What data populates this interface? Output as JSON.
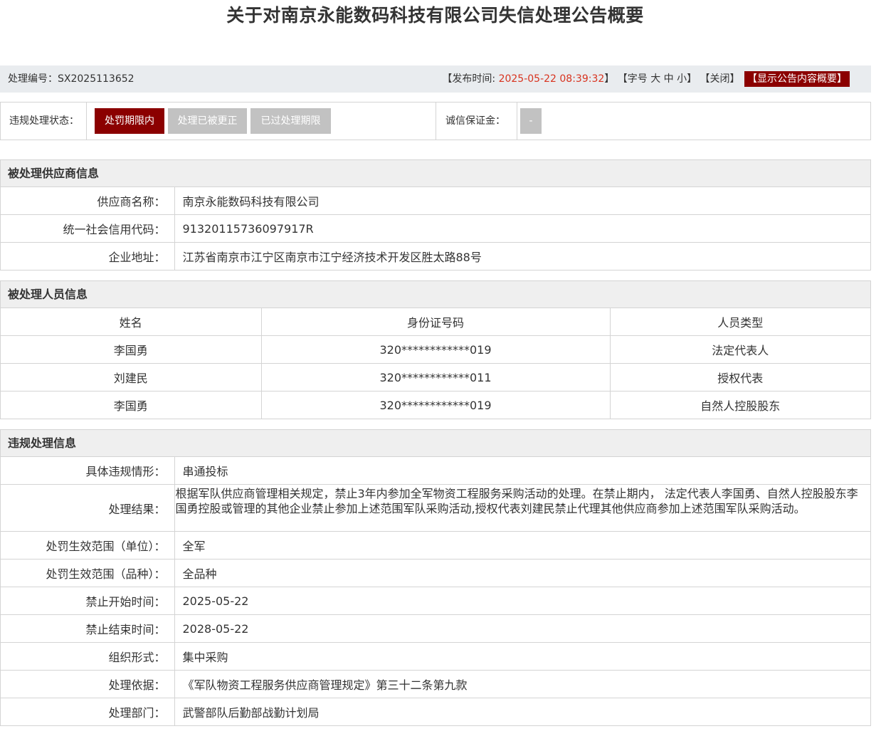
{
  "title": "关于对南京永能数码科技有限公司失信处理公告概要",
  "infobar": {
    "code_label": "处理编号：",
    "code_value": "SX2025113652",
    "publish_prefix": "【发布时间: ",
    "publish_time": "2025-05-22 08:39:32",
    "publish_suffix": "】",
    "font_prefix": "【字号 ",
    "font_large": "大",
    "font_medium": "中",
    "font_small": "小",
    "font_suffix": "】",
    "close_label": "【关闭】",
    "show_summary_label": "【显示公告内容概要】"
  },
  "status": {
    "label": "违规处理状态：",
    "buttons": [
      "处罚期限内",
      "处理已被更正",
      "已过处理期限"
    ],
    "active_index": 0,
    "deposit_label": "诚信保证金：",
    "deposit_value": "-"
  },
  "supplier": {
    "header": "被处理供应商信息",
    "rows": [
      {
        "key": "供应商名称：",
        "value": "南京永能数码科技有限公司"
      },
      {
        "key": "统一社会信用代码：",
        "value": "91320115736097917R"
      },
      {
        "key": "企业地址：",
        "value": "江苏省南京市江宁区南京市江宁经济技术开发区胜太路88号"
      }
    ]
  },
  "persons": {
    "header": "被处理人员信息",
    "columns": [
      "姓名",
      "身份证号码",
      "人员类型"
    ],
    "rows": [
      [
        "李国勇",
        "320************019",
        "法定代表人"
      ],
      [
        "刘建民",
        "320************011",
        "授权代表"
      ],
      [
        "李国勇",
        "320************019",
        "自然人控股股东"
      ]
    ]
  },
  "violation": {
    "header": "违规处理信息",
    "rows": [
      {
        "key": "具体违规情形：",
        "value": "串通投标"
      },
      {
        "key": "处理结果：",
        "value": " 根据军队供应商管理相关规定，禁止3年内参加全军物资工程服务采购活动的处理。在禁止期内， 法定代表人李国勇、自然人控股股东李国勇控股或管理的其他企业禁止参加上述范围军队采购活动,授权代表刘建民禁止代理其他供应商参加上述范围军队采购活动。"
      },
      {
        "key": "处罚生效范围（单位）：",
        "value": "全军"
      },
      {
        "key": "处罚生效范围（品种）：",
        "value": "全品种"
      },
      {
        "key": "禁止开始时间：",
        "value": "2025-05-22"
      },
      {
        "key": "禁止结束时间：",
        "value": "2028-05-22"
      },
      {
        "key": "组织形式：",
        "value": "集中采购"
      },
      {
        "key": "处理依据：",
        "value": "《军队物资工程服务供应商管理规定》第三十二条第九款"
      },
      {
        "key": "处理部门：",
        "value": "武警部队后勤部战勤计划局"
      }
    ]
  },
  "colors": {
    "accent": "#8b0000",
    "time_red": "#d8331f",
    "inactive_button": "#c2c2c2",
    "header_bg": "#efefef",
    "infobar_bg": "#e9ecef"
  }
}
